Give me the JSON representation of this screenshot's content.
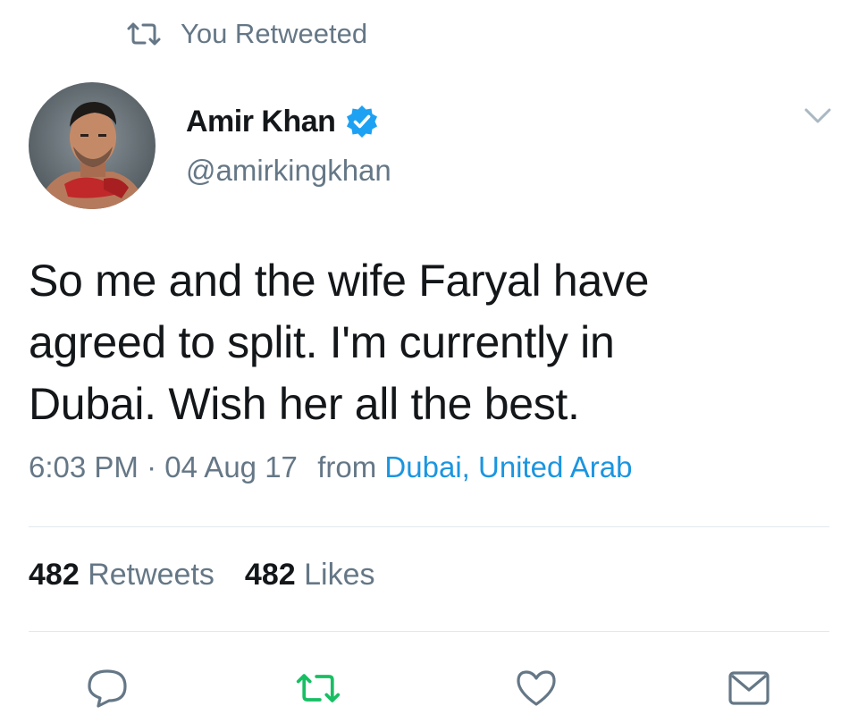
{
  "context": {
    "label": "You Retweeted",
    "icon": "retweet-icon"
  },
  "author": {
    "display_name": "Amir Khan",
    "handle": "@amirkingkhan",
    "verified": true,
    "verified_icon": "verified-badge-icon",
    "avatar": "avatar"
  },
  "tweet": {
    "text_lines": [
      "So me and the wife Faryal have",
      "agreed to split. I'm currently in",
      "Dubai. Wish her all the best."
    ],
    "time": "6:03 PM",
    "separator": "·",
    "date": "04 Aug 17",
    "from_label": "from",
    "location": "Dubai, United Arab"
  },
  "stats": {
    "retweets_count": "482",
    "retweets_label": "Retweets",
    "likes_count": "482",
    "likes_label": "Likes"
  },
  "actions": {
    "reply": "reply-icon",
    "retweet": "retweet-icon",
    "like": "heart-icon",
    "dm": "direct-message-icon"
  },
  "colors": {
    "text_primary": "#14171a",
    "text_secondary": "#657786",
    "link": "#1b95e0",
    "verified": "#1da1f2",
    "retweeted": "#17bf63",
    "divider": "#e1e8ed"
  }
}
